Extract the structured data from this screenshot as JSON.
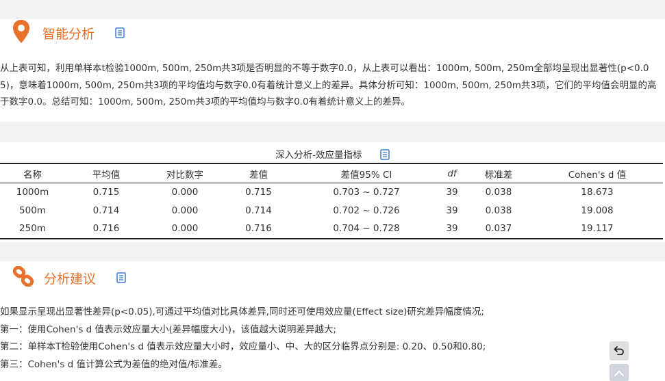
{
  "section1": {
    "title": "智能分析",
    "lines": [
      "从上表可知，利用单样本t检验1000m, 500m, 250m共3项是否明显的不等于数字0.0，从上表可以看出：1000m, 500m, 250m全部均呈现出显著性(p<0.0",
      "5)，意味着1000m, 500m, 250m共3项的平均值均与数字0.0有着统计意义上的差异。具体分析可知：1000m, 500m, 250m共3项，它们的平均值会明显的高",
      "于数字0.0。总结可知：1000m, 500m, 250m共3项的平均值均与数字0.0有着统计意义上的差异。"
    ]
  },
  "table": {
    "title": "深入分析-效应量指标",
    "headers": [
      "名称",
      "平均值",
      "对比数字",
      "差值",
      "差值95% CI",
      "df",
      "标准差",
      "Cohen's d 值"
    ],
    "rows": [
      [
        "1000m",
        "0.715",
        "0.000",
        "0.715",
        "0.703 ~ 0.727",
        "39",
        "0.038",
        "18.673"
      ],
      [
        "500m",
        "0.714",
        "0.000",
        "0.714",
        "0.702 ~ 0.726",
        "39",
        "0.038",
        "19.008"
      ],
      [
        "250m",
        "0.716",
        "0.000",
        "0.716",
        "0.704 ~ 0.728",
        "39",
        "0.037",
        "19.117"
      ]
    ]
  },
  "section2": {
    "title": "分析建议",
    "items": [
      "如果显示呈现出显著性差异(p<0.05),可通过平均值对比具体差异,同时还可使用效应量(Effect size)研究差异幅度情况;",
      "第一：使用Cohen's d 值表示效应量大小(差异幅度大小)，该值越大说明差异越大;",
      "第二：单样本T检验使用Cohen's d 值表示效应量大小时，效应量小、中、大的区分临界点分别是: 0.20、0.50和0.80;",
      "第三：Cohen's d 值计算公式为差值的绝对值/标准差。"
    ]
  },
  "colors": {
    "accent": "#e8722c",
    "icon_blue": "#3b7bd4"
  }
}
